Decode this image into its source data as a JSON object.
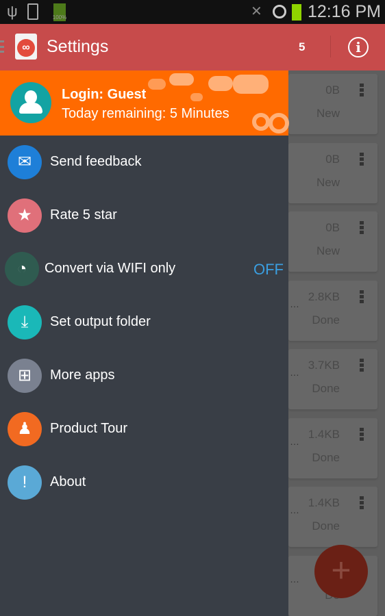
{
  "status_bar": {
    "time": "12:16 PM",
    "battery": "100%",
    "icons": [
      "usb-icon",
      "screen-share-icon",
      "battery-icon",
      "mute-icon",
      "blocked-icon",
      "battery-icon"
    ]
  },
  "app_bar": {
    "title": "Settings",
    "count": "5",
    "info_icon": "info-icon"
  },
  "drawer": {
    "login": "Login: Guest",
    "remaining": "Today remaining: 5 Minutes",
    "items": [
      {
        "label": "Send feedback",
        "icon": "envelope-icon",
        "color": "#1e7fd8"
      },
      {
        "label": "Rate 5 star",
        "icon": "star-icon",
        "color": "#e0707a"
      },
      {
        "label": "Convert via WIFI only",
        "icon": "wifi-icon",
        "color": "#2f5b50",
        "value": "OFF"
      },
      {
        "label": "Set output folder",
        "icon": "download-icon",
        "color": "#1ab8b8"
      },
      {
        "label": "More apps",
        "icon": "plus-box-icon",
        "color": "#7a8190"
      },
      {
        "label": "Product Tour",
        "icon": "person-icon",
        "color": "#f26a21"
      },
      {
        "label": "About",
        "icon": "exclamation-icon",
        "color": "#5aa9d6"
      }
    ]
  },
  "list": [
    {
      "size": "0B",
      "status": "New"
    },
    {
      "size": "0B",
      "status": "New"
    },
    {
      "size": "0B",
      "status": "New"
    },
    {
      "size": "2.8KB",
      "status": "Done"
    },
    {
      "size": "3.7KB",
      "status": "Done"
    },
    {
      "size": "1.4KB",
      "status": "Done"
    },
    {
      "size": "1.4KB",
      "status": "Done"
    },
    {
      "size": "2",
      "status": "Do"
    }
  ],
  "fab": {
    "label": "+"
  },
  "colors": {
    "app_bar": "#c74b4b",
    "drawer_header": "#ff6a00",
    "drawer_bg": "#393e46",
    "toggle_off": "#3a9ee0"
  }
}
